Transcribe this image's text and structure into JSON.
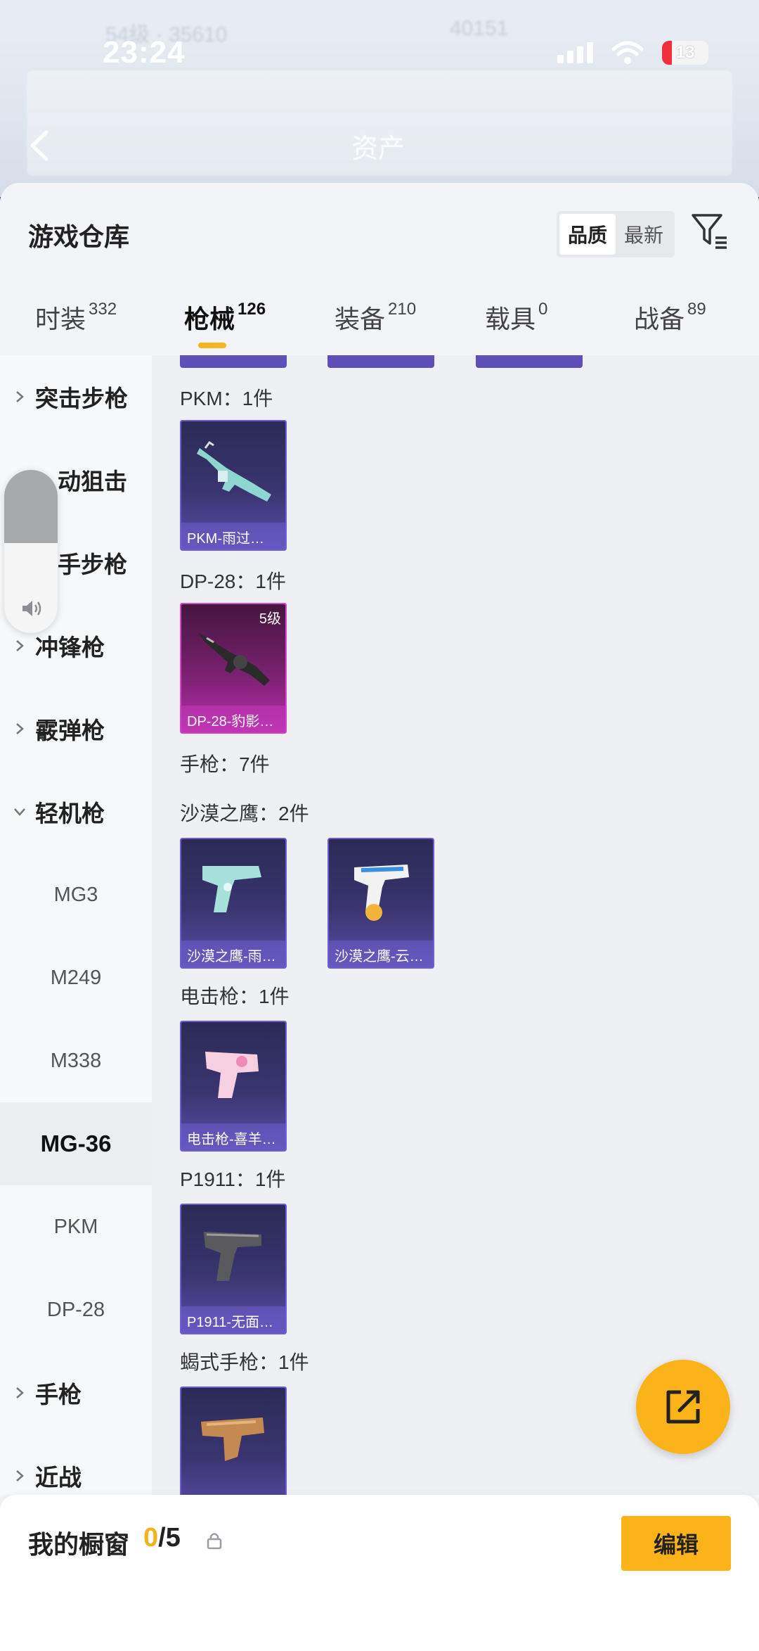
{
  "status_bar": {
    "time": "23:24",
    "battery": "13"
  },
  "header_bg": {
    "asset_label": "资产"
  },
  "sheet": {
    "title": "游戏仓库",
    "sort": [
      "品质",
      "最新"
    ],
    "sort_active": "品质"
  },
  "tabs": [
    {
      "label": "时装",
      "count": "332"
    },
    {
      "label": "枪械",
      "count": "126"
    },
    {
      "label": "装备",
      "count": "210"
    },
    {
      "label": "载具",
      "count": "0"
    },
    {
      "label": "战备",
      "count": "89"
    }
  ],
  "sidenav": {
    "categories": [
      "突击步枪",
      "栓动狙击",
      "连发步枪",
      "冲锋枪",
      "霰弹枪",
      "轻机枪",
      "手枪",
      "近战"
    ],
    "categories_display": [
      "突击步枪",
      "动狙击",
      "手步枪",
      "冲锋枪",
      "霰弹枪",
      "轻机枪",
      "手枪",
      "近战"
    ],
    "sub_items": [
      "MG3",
      "M249",
      "M338",
      "MG-36",
      "PKM",
      "DP-28"
    ],
    "active_sub": "MG-36"
  },
  "content": {
    "sections": [
      {
        "label": "PKM：1件"
      },
      {
        "label": "DP-28：1件"
      },
      {
        "label": "手枪：7件"
      },
      {
        "label": "沙漠之鹰：2件"
      },
      {
        "label": "电击枪：1件"
      },
      {
        "label": "P1911：1件"
      },
      {
        "label": "蝎式手枪：1件"
      }
    ],
    "cards": [
      {
        "name": "PKM-雨过…",
        "level": ""
      },
      {
        "name": "DP-28-豹影…",
        "level": "5级"
      },
      {
        "name": "沙漠之鹰-雨…",
        "level": ""
      },
      {
        "name": "沙漠之鹰-云…",
        "level": ""
      },
      {
        "name": "电击枪-喜羊…",
        "level": ""
      },
      {
        "name": "P1911-无面…",
        "level": ""
      }
    ]
  },
  "showcase": {
    "title": "我的橱窗",
    "current": "0",
    "total": "/5",
    "edit_label": "编辑"
  },
  "colors": {
    "accent": "#fbb319",
    "rare_card": "#5b4fae",
    "epic_card": "#bb2fb0"
  }
}
